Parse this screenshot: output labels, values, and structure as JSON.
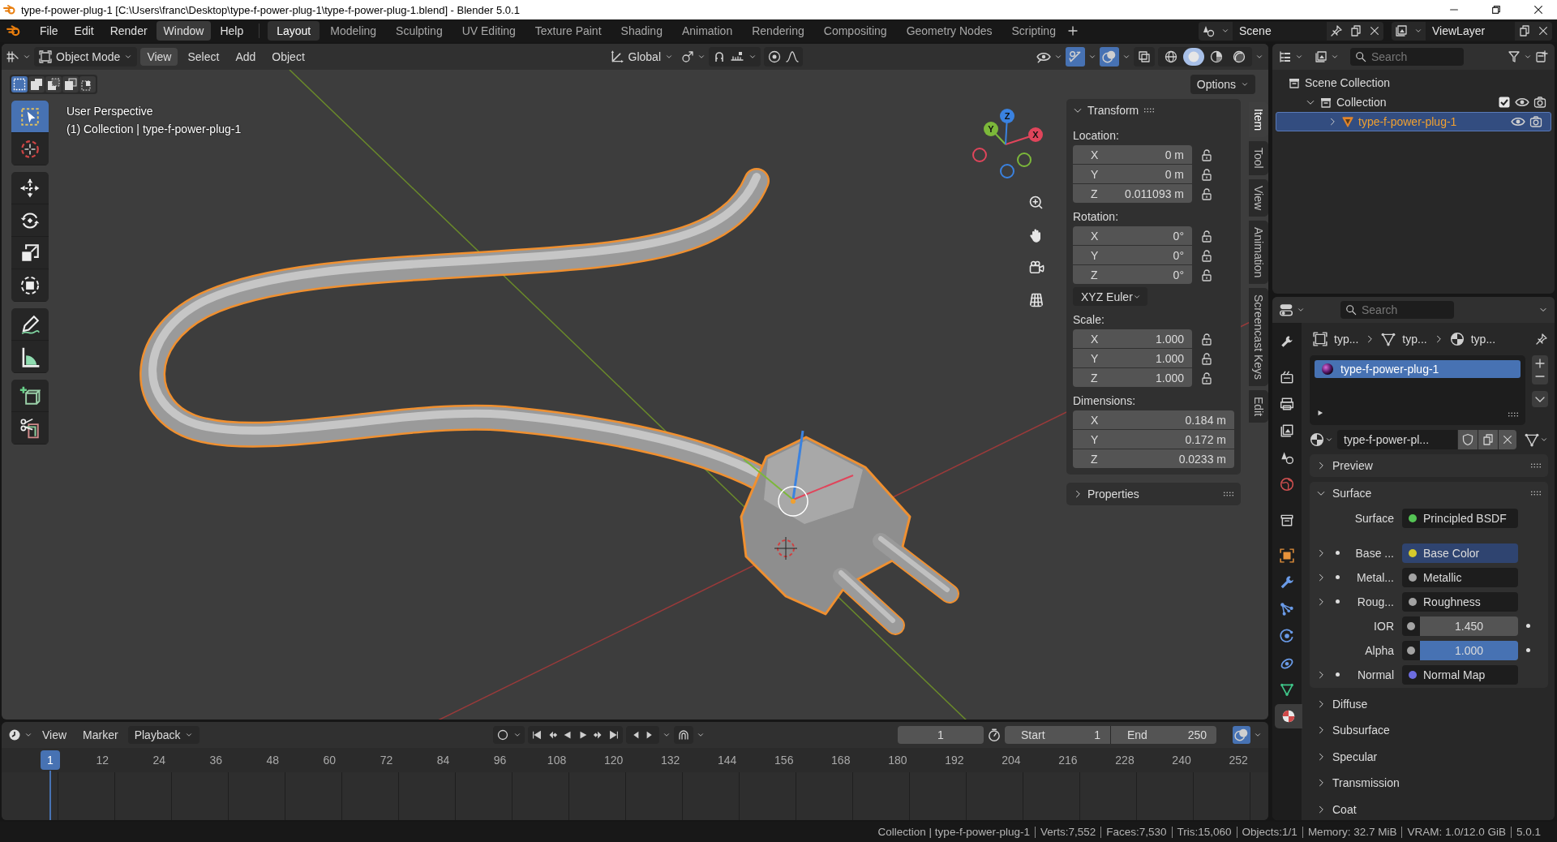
{
  "window": {
    "title": "type-f-power-plug-1 [C:\\Users\\franc\\Desktop\\type-f-power-plug-1\\type-f-power-plug-1.blend] - Blender 5.0.1"
  },
  "menu": [
    {
      "label": "File",
      "selected": false
    },
    {
      "label": "Edit",
      "selected": false
    },
    {
      "label": "Render",
      "selected": false
    },
    {
      "label": "Window",
      "selected": true
    },
    {
      "label": "Help",
      "selected": false
    }
  ],
  "workspaces": [
    {
      "label": "Layout",
      "selected": true
    },
    {
      "label": "Modeling",
      "selected": false
    },
    {
      "label": "Sculpting",
      "selected": false
    },
    {
      "label": "UV Editing",
      "selected": false
    },
    {
      "label": "Texture Paint",
      "selected": false
    },
    {
      "label": "Shading",
      "selected": false
    },
    {
      "label": "Animation",
      "selected": false
    },
    {
      "label": "Rendering",
      "selected": false
    },
    {
      "label": "Compositing",
      "selected": false
    },
    {
      "label": "Geometry Nodes",
      "selected": false
    },
    {
      "label": "Scripting",
      "selected": false
    }
  ],
  "scene": "Scene",
  "view_layer": "ViewLayer",
  "viewport": {
    "mode": "Object Mode",
    "menus": [
      {
        "label": "View",
        "selected": true
      },
      {
        "label": "Select",
        "selected": false
      },
      {
        "label": "Add",
        "selected": false
      },
      {
        "label": "Object",
        "selected": false
      }
    ],
    "orientation": "Global",
    "shading": [
      {
        "kind": "wireframe",
        "selected": false
      },
      {
        "kind": "solid",
        "selected": true
      },
      {
        "kind": "material",
        "selected": false
      },
      {
        "kind": "rendered",
        "selected": false
      }
    ],
    "options": "Options",
    "select_modes": [
      {
        "kind": "set",
        "selected": true
      },
      {
        "kind": "extend",
        "selected": false
      },
      {
        "kind": "subtract",
        "selected": false
      },
      {
        "kind": "invert",
        "selected": false
      },
      {
        "kind": "intersect",
        "selected": false
      }
    ],
    "info": [
      "User Perspective",
      "(1) Collection | type-f-power-plug-1"
    ],
    "tool_groups": [
      {
        "tools": [
          {
            "kind": "select-box",
            "selected": true
          },
          {
            "kind": "cursor",
            "selected": false
          }
        ]
      },
      {
        "tools": [
          {
            "kind": "move",
            "selected": false
          },
          {
            "kind": "rotate",
            "selected": false
          },
          {
            "kind": "scale",
            "selected": false
          },
          {
            "kind": "transform",
            "selected": false
          }
        ]
      },
      {
        "tools": [
          {
            "kind": "annotate",
            "selected": false
          },
          {
            "kind": "measure",
            "selected": false
          }
        ]
      },
      {
        "tools": [
          {
            "kind": "add-cube",
            "selected": false
          },
          {
            "kind": "cut",
            "selected": false
          }
        ]
      }
    ],
    "gizmo_axes": [
      "X",
      "Y",
      "Z"
    ],
    "transform": {
      "title": "Transform",
      "expanded": true,
      "groups": [
        {
          "label": "Location:",
          "fields": [
            {
              "axis": "X",
              "value": "0 m",
              "locked": false
            },
            {
              "axis": "Y",
              "value": "0 m",
              "locked": false
            },
            {
              "axis": "Z",
              "value": "0.011093 m",
              "locked": false
            }
          ]
        },
        {
          "label": "Rotation:",
          "fields": [
            {
              "axis": "X",
              "value": "0°",
              "locked": false
            },
            {
              "axis": "Y",
              "value": "0°",
              "locked": false
            },
            {
              "axis": "Z",
              "value": "0°",
              "locked": false
            }
          ],
          "mode": "XYZ Euler"
        },
        {
          "label": "Scale:",
          "fields": [
            {
              "axis": "X",
              "value": "1.000",
              "locked": false
            },
            {
              "axis": "Y",
              "value": "1.000",
              "locked": false
            },
            {
              "axis": "Z",
              "value": "1.000",
              "locked": false
            }
          ]
        },
        {
          "label": "Dimensions:",
          "fields": [
            {
              "axis": "X",
              "value": "0.184 m"
            },
            {
              "axis": "Y",
              "value": "0.172 m"
            },
            {
              "axis": "Z",
              "value": "0.0233 m"
            }
          ]
        }
      ]
    },
    "properties_panel": {
      "title": "Properties",
      "expanded": false
    },
    "sidebar_tabs": [
      {
        "label": "Item",
        "selected": true
      },
      {
        "label": "Tool",
        "selected": false
      },
      {
        "label": "View",
        "selected": false
      },
      {
        "label": "Animation",
        "selected": false
      },
      {
        "label": "Screencast Keys",
        "selected": false
      },
      {
        "label": "Edit",
        "selected": false
      }
    ]
  },
  "outliner": {
    "search_placeholder": "Search",
    "tree": [
      {
        "kind": "scene-collection",
        "label": "Scene Collection",
        "selected": false,
        "children": [
          {
            "kind": "collection",
            "label": "Collection",
            "selected": false,
            "expanded": true,
            "checked": true,
            "children": [
              {
                "kind": "object",
                "label": "type-f-power-plug-1",
                "selected": true,
                "expanded": false
              }
            ]
          }
        ]
      }
    ]
  },
  "properties": {
    "search_placeholder": "Search",
    "tabs": [
      {
        "kind": "tool",
        "selected": false
      },
      {
        "kind": "render",
        "selected": false
      },
      {
        "kind": "output",
        "selected": false
      },
      {
        "kind": "view-layer",
        "selected": false
      },
      {
        "kind": "scene",
        "selected": false
      },
      {
        "kind": "world",
        "selected": false
      },
      {
        "kind": "collection",
        "selected": false
      },
      {
        "kind": "object",
        "selected": false
      },
      {
        "kind": "modifiers",
        "selected": false
      },
      {
        "kind": "particles",
        "selected": false
      },
      {
        "kind": "physics",
        "selected": false
      },
      {
        "kind": "constraints",
        "selected": false
      },
      {
        "kind": "data",
        "selected": false
      },
      {
        "kind": "material",
        "selected": true
      }
    ],
    "breadcrumb": [
      {
        "kind": "object",
        "label": "typ..."
      },
      {
        "kind": "mesh",
        "label": "typ..."
      },
      {
        "kind": "material",
        "label": "typ..."
      }
    ],
    "slots": [
      {
        "name": "type-f-power-plug-1",
        "selected": true
      }
    ],
    "material": "type-f-power-pl...",
    "panels": [
      {
        "title": "Preview",
        "expanded": false
      },
      {
        "title": "Surface",
        "expanded": true,
        "rows": [
          {
            "kind": "link",
            "label": "Surface",
            "value": "Principled BSDF",
            "color": "#55c455",
            "expandable": false,
            "selected": false
          },
          {
            "kind": "link",
            "label": "Base ...",
            "value": "Base Color",
            "color": "#d6c92b",
            "expandable": true,
            "selected": true
          },
          {
            "kind": "link",
            "label": "Metal...",
            "value": "Metallic",
            "color": "#a3a3a3",
            "expandable": true,
            "selected": false
          },
          {
            "kind": "link",
            "label": "Roug...",
            "value": "Roughness",
            "color": "#a3a3a3",
            "expandable": true,
            "selected": false
          },
          {
            "kind": "number",
            "label": "IOR",
            "value": "1.450",
            "color": "#a3a3a3"
          },
          {
            "kind": "slider",
            "label": "Alpha",
            "value": "1.000",
            "color": "#a3a3a3",
            "level": 1
          },
          {
            "kind": "link",
            "label": "Normal",
            "value": "Normal Map",
            "color": "#6c6ce0",
            "expandable": true,
            "selected": false
          }
        ]
      },
      {
        "title": "Diffuse",
        "expanded": false
      },
      {
        "title": "Subsurface",
        "expanded": false
      },
      {
        "title": "Specular",
        "expanded": false
      },
      {
        "title": "Transmission",
        "expanded": false
      },
      {
        "title": "Coat",
        "expanded": false
      }
    ]
  },
  "timeline": {
    "menus": [
      "View",
      "Marker"
    ],
    "playback": "Playback",
    "frame": "1",
    "start_label": "Start",
    "start": "1",
    "end_label": "End",
    "end": "250",
    "playhead": "1",
    "ruler": [
      "12",
      "24",
      "36",
      "48",
      "60",
      "72",
      "84",
      "96",
      "108",
      "120",
      "132",
      "144",
      "156",
      "168",
      "180",
      "192",
      "204",
      "216",
      "228",
      "240",
      "252"
    ]
  },
  "status": [
    "Collection | type-f-power-plug-1",
    "Verts:7,552",
    "Faces:7,530",
    "Tris:15,060",
    "Objects:1/1",
    "Memory: 32.7 MiB",
    "VRAM: 1.0/12.0 GiB",
    "5.0.1"
  ]
}
